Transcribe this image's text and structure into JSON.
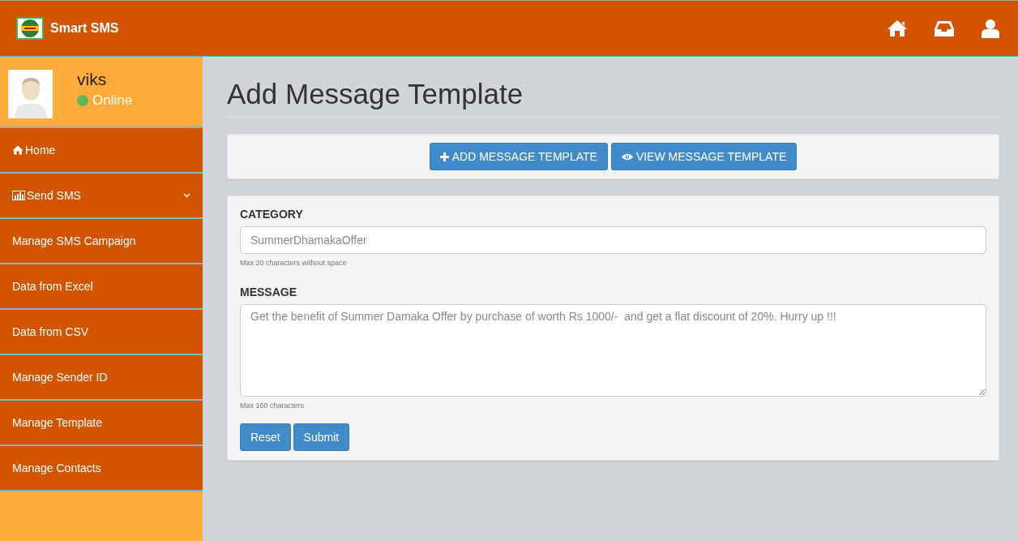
{
  "app": {
    "title": "Smart SMS"
  },
  "user": {
    "name": "viks",
    "status": "Online",
    "online": true
  },
  "sidebar": {
    "items": [
      {
        "label": "Home",
        "kind": "home",
        "expandable": false
      },
      {
        "label": "Send SMS",
        "kind": "chart",
        "expandable": true
      },
      {
        "label": "Manage SMS Campaign",
        "kind": "plain",
        "expandable": false
      },
      {
        "label": "Data from Excel",
        "kind": "plain",
        "expandable": false
      },
      {
        "label": "Data from CSV",
        "kind": "plain",
        "expandable": false
      },
      {
        "label": "Manage Sender ID",
        "kind": "plain",
        "expandable": false
      },
      {
        "label": "Manage Template",
        "kind": "plain",
        "expandable": false
      },
      {
        "label": "Manage Contacts",
        "kind": "plain",
        "expandable": false
      }
    ]
  },
  "page": {
    "title": "Add Message Template"
  },
  "actions": [
    {
      "label": "ADD MESSAGE TEMPLATE",
      "kind": "add"
    },
    {
      "label": "VIEW MESSAGE TEMPLATE",
      "kind": "view"
    }
  ],
  "form": {
    "fields": [
      {
        "kind": "input",
        "label": "CATEGORY",
        "placeholder": "SummerDhamakaOffer",
        "hint": "Max 20 characters without space"
      },
      {
        "kind": "textarea",
        "label": "MESSAGE",
        "placeholder": "Get the benefit of Summer Damaka Offer by purchase of worth Rs 1000/-  and get a flat discount of 20%. Hurry up !!!",
        "hint": "Max 160 characters"
      }
    ],
    "buttons": [
      "Reset",
      "Submit"
    ]
  }
}
